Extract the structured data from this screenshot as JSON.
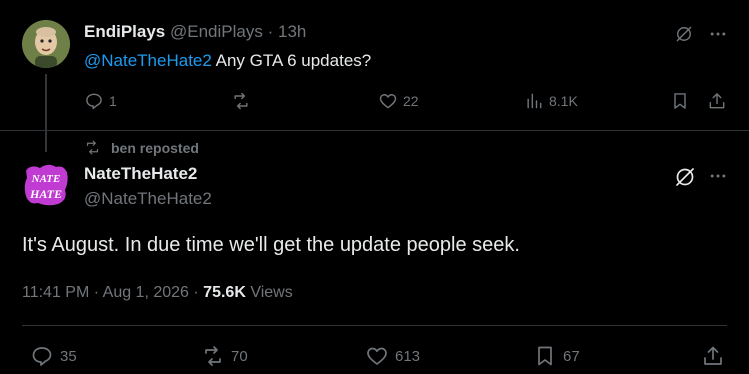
{
  "parent_tweet": {
    "display_name": "EndiPlays",
    "handle": "@EndiPlays",
    "separator": "·",
    "time": "13h",
    "mention": "@NateTheHate2",
    "text": " Any GTA 6 updates?",
    "replies": "1",
    "reposts": "",
    "likes": "22",
    "views": "8.1K"
  },
  "repost_context": {
    "text": "ben reposted"
  },
  "main_tweet": {
    "display_name": "NateTheHate2",
    "handle": "@NateTheHate2",
    "avatar_text_top": "NATE",
    "avatar_text_bottom": "HATE",
    "text": "It's August. In due time we'll get the update people seek.",
    "time": "11:41 PM",
    "separator": "·",
    "date": "Aug 1, 2026",
    "separator2": "·",
    "views_count": "75.6K",
    "views_label": "Views",
    "replies": "35",
    "reposts": "70",
    "likes": "613",
    "bookmarks": "67"
  },
  "icons": {
    "grok": "grok-icon",
    "more": "more-icon",
    "reply": "reply-icon",
    "repost": "repost-icon",
    "like": "like-icon",
    "views": "analytics-icon",
    "bookmark": "bookmark-icon",
    "share": "share-icon"
  },
  "colors": {
    "background": "#000000",
    "text": "#e7e9ea",
    "muted": "#71767b",
    "link": "#1d9bf0",
    "border": "#2f3336",
    "avatar_accent": "#c03bd1"
  }
}
